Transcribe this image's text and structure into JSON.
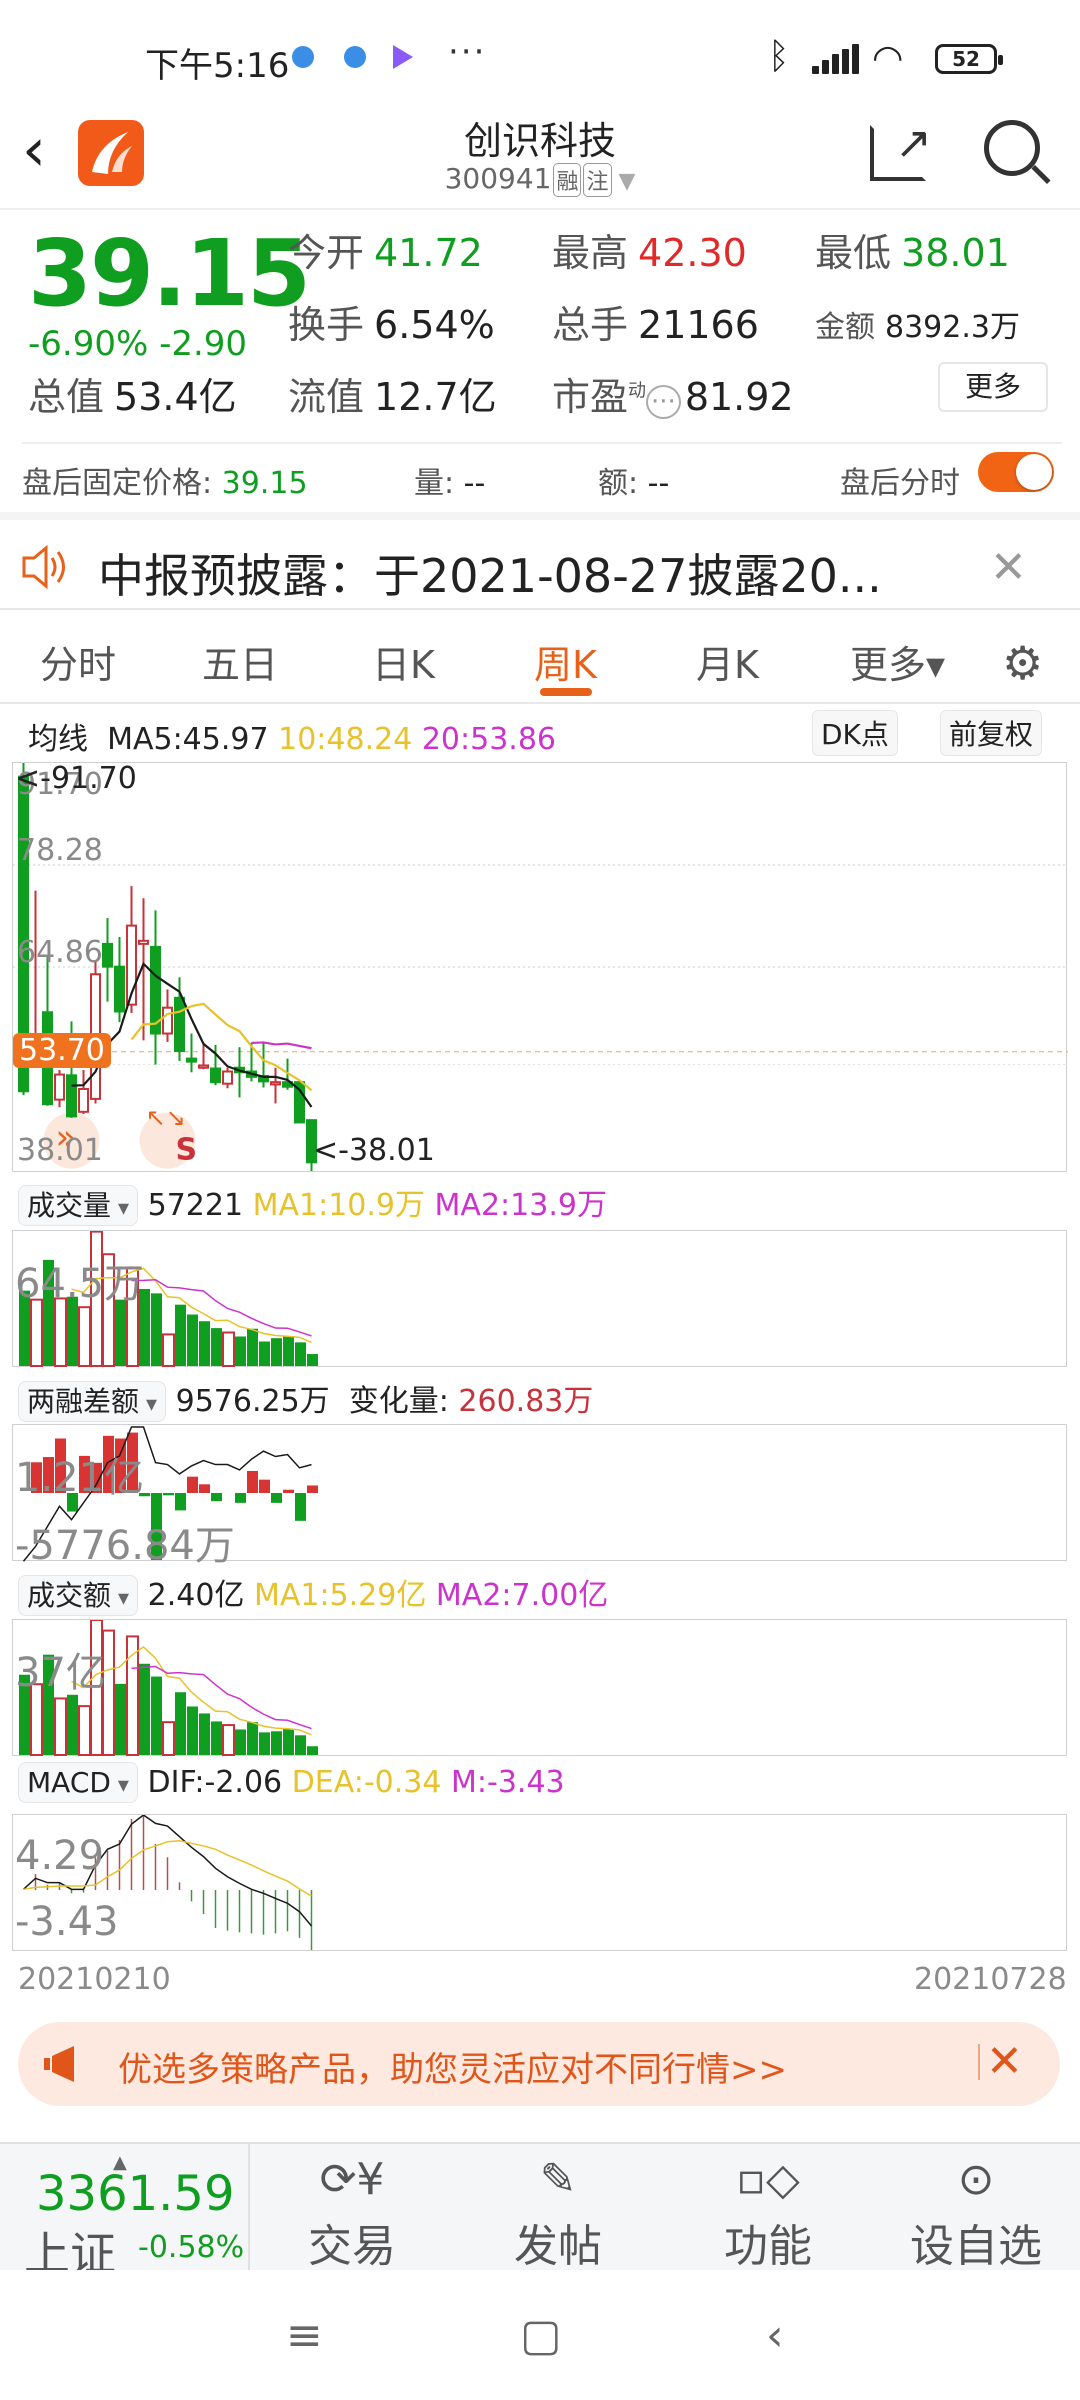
{
  "status_bar": {
    "time": "下午5:16",
    "more": "···",
    "battery": "52"
  },
  "header": {
    "title": "创识科技",
    "code": "300941",
    "tags": [
      "融",
      "注"
    ]
  },
  "quote": {
    "price": "39.15",
    "change_pct": "-6.90%",
    "change_amt": "-2.90",
    "open_label": "今开",
    "open": "41.72",
    "high_label": "最高",
    "high": "42.30",
    "low_label": "最低",
    "low": "38.01",
    "turnover_label": "换手",
    "turnover": "6.54%",
    "volume_label": "总手",
    "volume": "21166",
    "amount_label": "金额",
    "amount": "8392.3万",
    "mktcap_label": "总值",
    "mktcap": "53.4亿",
    "float_label": "流值",
    "float": "12.7亿",
    "pe_label": "市盈",
    "pe_sup": "动",
    "pe": "81.92",
    "more_button": "更多"
  },
  "after_hours": {
    "fixed_price_label": "盘后固定价格:",
    "fixed_price": "39.15",
    "vol_label": "量:",
    "vol": "--",
    "amt_label": "额:",
    "amt": "--",
    "toggle_label": "盘后分时",
    "toggle_on": true
  },
  "notice": {
    "text": "中报预披露：于2021-08-27披露20..."
  },
  "tabs": [
    {
      "label": "分时"
    },
    {
      "label": "五日"
    },
    {
      "label": "日K"
    },
    {
      "label": "周K",
      "active": true
    },
    {
      "label": "月K"
    },
    {
      "label": "更多▾"
    }
  ],
  "ma_bar": {
    "label": "均线",
    "ma5": "MA5:45.97",
    "ma10": "10:48.24",
    "ma20": "20:53.86",
    "dk_button": "DK点",
    "adjust_button": "前复权"
  },
  "colors": {
    "up": "#c8323a",
    "down": "#0f9e1f",
    "ma5": "#1a1a1a",
    "ma10": "#e8c22a",
    "ma20": "#cc33cc",
    "accent": "#e8611a"
  },
  "volume_bar": {
    "selector": "成交量",
    "value": "57221",
    "ma1": "MA1:10.9万",
    "ma2": "MA2:13.9万"
  },
  "margin_bar": {
    "selector": "两融差额",
    "value": "9576.25万",
    "change_label": "变化量:",
    "change": "260.83万"
  },
  "amount_bar": {
    "selector": "成交额",
    "value": "2.40亿",
    "ma1": "MA1:5.29亿",
    "ma2": "MA2:7.00亿"
  },
  "macd_bar": {
    "selector": "MACD",
    "dif": "DIF:-2.06",
    "dea": "DEA:-0.34",
    "m": "M:-3.43"
  },
  "chart_data": [
    {
      "type": "candlestick",
      "title": "周K",
      "ylim": [
        38.01,
        91.7
      ],
      "y_labels": [
        "91.70",
        "78.28",
        "64.86",
        "38.01"
      ],
      "current_price_label": "53.70",
      "max_marker": "<-91.70",
      "min_marker": "<-38.01",
      "x_start": "20210210",
      "x_end": "20210728",
      "slots": 88,
      "ohlc": [
        [
          89.9,
          91.7,
          48.0,
          48.5
        ],
        [
          53.0,
          74.9,
          52.0,
          55.0
        ],
        [
          58.9,
          66.3,
          46.6,
          46.8
        ],
        [
          47.4,
          51.3,
          46.4,
          50.7
        ],
        [
          50.6,
          57.7,
          45.0,
          45.2
        ],
        [
          45.8,
          51.3,
          45.5,
          48.8
        ],
        [
          47.5,
          65.7,
          46.9,
          63.9
        ],
        [
          67.9,
          71.3,
          60.3,
          64.9
        ],
        [
          64.9,
          68.8,
          57.6,
          59.0
        ],
        [
          59.9,
          75.5,
          58.8,
          70.3
        ],
        [
          67.9,
          73.9,
          55.2,
          68.3
        ],
        [
          67.5,
          72.3,
          52.0,
          56.1
        ],
        [
          56.1,
          61.9,
          55.0,
          59.5
        ],
        [
          60.8,
          63.5,
          52.5,
          53.8
        ],
        [
          52.8,
          56.1,
          51.0,
          52.4
        ],
        [
          51.6,
          54.9,
          51.4,
          51.9
        ],
        [
          51.5,
          54.6,
          49.3,
          49.7
        ],
        [
          49.5,
          51.6,
          48.9,
          51.1
        ],
        [
          51.6,
          54.3,
          47.7,
          51.0
        ],
        [
          51.1,
          54.9,
          49.8,
          50.4
        ],
        [
          50.5,
          54.9,
          49.0,
          49.8
        ],
        [
          49.4,
          51.6,
          46.9,
          49.7
        ],
        [
          49.7,
          52.8,
          48.7,
          49.1
        ],
        [
          49.7,
          49.9,
          44.3,
          44.4
        ],
        [
          44.7,
          44.8,
          38.01,
          39.15
        ]
      ],
      "ma_periods": [
        5,
        10,
        20
      ],
      "signals": [
        {
          "index": 5,
          "glyph": "»"
        },
        {
          "index": 13,
          "glyph": "S"
        }
      ]
    },
    {
      "type": "bar",
      "title": "成交量",
      "unit": "万",
      "max_label": "64.5万",
      "ymax": 64.5,
      "values": [
        36.0,
        31.7,
        50.7,
        32.3,
        33.1,
        28.1,
        64.2,
        53.4,
        31.7,
        47.1,
        36.8,
        34.7,
        15.1,
        29.3,
        24.6,
        21.4,
        18.1,
        16.0,
        14.1,
        17.8,
        11.7,
        13.3,
        14.3,
        11.3,
        5.72
      ],
      "colors": [
        "d",
        "u",
        "d",
        "u",
        "d",
        "u",
        "u",
        "u",
        "d",
        "u",
        "d",
        "d",
        "u",
        "d",
        "d",
        "d",
        "d",
        "u",
        "d",
        "d",
        "d",
        "d",
        "d",
        "d",
        "d"
      ],
      "ma_periods": [
        5,
        10
      ]
    },
    {
      "type": "bar",
      "title": "两融差额",
      "unit": "万",
      "top_label": "1.21亿",
      "bottom_label": "-5776.84万",
      "bar_values": [
        0,
        2650,
        3100,
        4700,
        -1600,
        3200,
        2600,
        4930,
        4700,
        5210,
        -280,
        -5777,
        -200,
        -1500,
        1410,
        750,
        -700,
        0,
        -850,
        1900,
        1150,
        -850,
        280,
        -2400,
        650
      ],
      "line_values": [
        3090,
        4080,
        5430,
        6780,
        5880,
        7010,
        8140,
        9710,
        10160,
        12100,
        12100,
        9710,
        9580,
        8950,
        9490,
        9850,
        9580,
        9580,
        9220,
        9940,
        10480,
        10120,
        10250,
        9360,
        9576.25
      ],
      "line_ymax": 12100
    },
    {
      "type": "bar",
      "title": "成交额",
      "unit": "亿",
      "max_label": "37亿",
      "ymax": 37,
      "values": [
        22.0,
        19.4,
        27.5,
        15.5,
        16.5,
        13.4,
        37.0,
        34.1,
        19.5,
        32.5,
        25.0,
        21.5,
        9.0,
        17.2,
        13.3,
        11.4,
        9.2,
        8.2,
        7.0,
        9.0,
        6.2,
        6.5,
        7.2,
        5.4,
        2.4
      ],
      "colors": [
        "d",
        "u",
        "d",
        "u",
        "d",
        "u",
        "u",
        "u",
        "d",
        "u",
        "d",
        "d",
        "u",
        "d",
        "d",
        "d",
        "d",
        "u",
        "d",
        "d",
        "d",
        "d",
        "d",
        "d",
        "d"
      ],
      "ma_periods": [
        5,
        10
      ]
    },
    {
      "type": "line",
      "title": "MACD",
      "ylim": [
        -3.43,
        4.29
      ],
      "top_label": "4.29",
      "bottom_label": "-3.43",
      "hist": [
        0,
        0.91,
        0.3,
        0.38,
        -0.19,
        -0.15,
        1.87,
        2.25,
        2.86,
        4.06,
        4.25,
        2.63,
        1.87,
        0.44,
        -0.65,
        -1.37,
        -2.17,
        -2.32,
        -2.42,
        -2.48,
        -2.55,
        -2.48,
        -2.36,
        -2.74,
        -3.43
      ],
      "dif": [
        0.04,
        0.67,
        0.42,
        0.42,
        0.04,
        0.04,
        1.43,
        2.33,
        2.63,
        3.77,
        4.29,
        3.81,
        3.66,
        3.05,
        2.44,
        1.91,
        1.24,
        0.76,
        0.38,
        0.04,
        -0.19,
        -0.48,
        -0.76,
        -1.24,
        -2.06
      ],
      "dea": [
        0.04,
        0.15,
        0.19,
        0.23,
        0.23,
        0.23,
        0.29,
        0.76,
        1.14,
        1.81,
        2.29,
        2.52,
        2.76,
        2.82,
        2.67,
        2.52,
        2.33,
        2.0,
        1.72,
        1.43,
        1.1,
        0.8,
        0.51,
        0.06,
        -0.34
      ]
    }
  ],
  "x_axis": {
    "start": "20210210",
    "end": "20210728"
  },
  "ad_banner": {
    "text": "优选多策略产品，助您灵活应对不同行情>>"
  },
  "index_ticker": {
    "value": "3361.59",
    "name": "上证",
    "change": "-0.58%"
  },
  "bottom_nav": [
    {
      "icon": "trade-icon",
      "label": "交易"
    },
    {
      "icon": "post-icon",
      "label": "发帖"
    },
    {
      "icon": "functions-icon",
      "label": "功能"
    },
    {
      "icon": "add-watchlist-icon",
      "label": "设自选"
    }
  ]
}
